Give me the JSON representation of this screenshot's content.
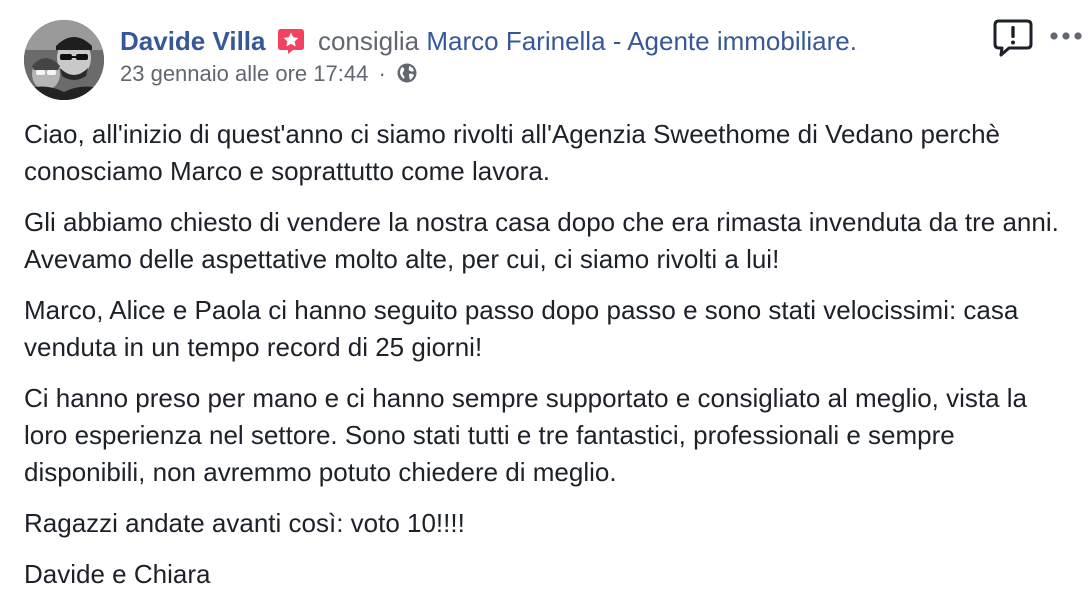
{
  "post": {
    "author": "Davide Villa",
    "verb": "consiglia",
    "target": "Marco Farinella - Agente immobiliare.",
    "timestamp": "23 gennaio alle ore 17:44",
    "separator": "·",
    "privacy_icon": "globe-icon",
    "badge_icon": "recommendation-star-icon",
    "report_icon": "report-icon",
    "more_icon": "more-options-icon",
    "paragraphs": [
      "Ciao, all'inizio di quest'anno ci siamo rivolti all'Agenzia Sweethome di Vedano perchè conosciamo Marco e soprattutto come lavora.",
      "Gli abbiamo chiesto di vendere la nostra casa dopo che era rimasta invenduta da tre anni. Avevamo delle aspettative molto alte, per cui, ci siamo rivolti a lui!",
      "Marco, Alice e Paola ci hanno seguito passo dopo passo e sono stati velocissimi: casa venduta in un tempo record di 25 giorni!",
      "Ci hanno preso per mano e ci hanno sempre supportato e consigliato al meglio, vista la loro esperienza nel settore. Sono stati tutti e tre fantastici, professionali e sempre disponibili, non avremmo potuto chiedere di meglio.",
      "Ragazzi andate avanti così: voto 10!!!!",
      "Davide e Chiara"
    ]
  },
  "colors": {
    "link": "#365899",
    "meta": "#606770",
    "text": "#1d2129",
    "badge": "#f3425f"
  }
}
